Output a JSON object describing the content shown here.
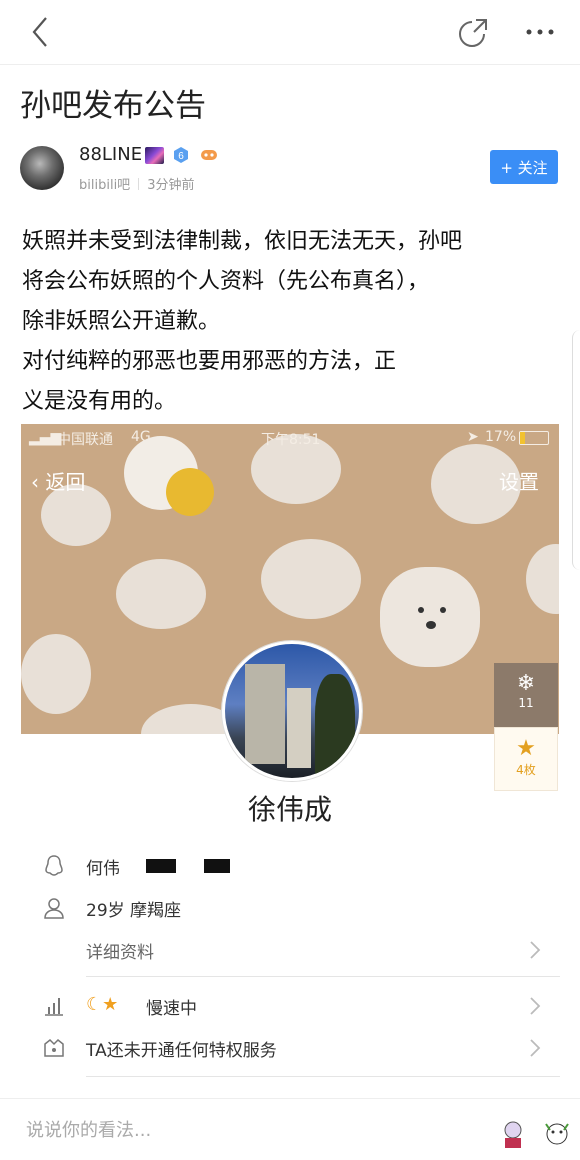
{
  "post": {
    "title": "孙吧发布公告",
    "author": "88LINE",
    "level_badge": "6",
    "source": "bilibili吧",
    "time": "3分钟前",
    "follow_label": "+ 关注",
    "body_lines": [
      "妖照并未受到法律制裁，依旧无法无天，孙吧",
      "将会公布妖照的个人资料（先公布真名），",
      "除非妖照公开道歉。",
      "对付纯粹的邪恶也要用邪恶的方法，正",
      "义是没有用的。"
    ]
  },
  "embedded": {
    "status": {
      "carrier": "中国联通",
      "network": "4G",
      "time": "下午8:51",
      "battery": "17%"
    },
    "back_label": "返回",
    "settings_label": "设置",
    "snow_count": "11",
    "coin_count": "4枚",
    "profile_name": "徐伟成",
    "info_rows": [
      {
        "icon": "qq-penguin-icon",
        "text": "何伟"
      },
      {
        "icon": "person-icon",
        "text": "29岁 摩羯座"
      },
      {
        "icon": "",
        "text": "详细资料"
      },
      {
        "icon": "chart-icon",
        "text": "慢速中"
      },
      {
        "icon": "privilege-icon",
        "text": "TA还未开通任何特权服务"
      }
    ]
  },
  "comment": {
    "placeholder": "说说你的看法..."
  },
  "colors": {
    "accent": "#3a8ef6",
    "banner": "#c9a885"
  }
}
